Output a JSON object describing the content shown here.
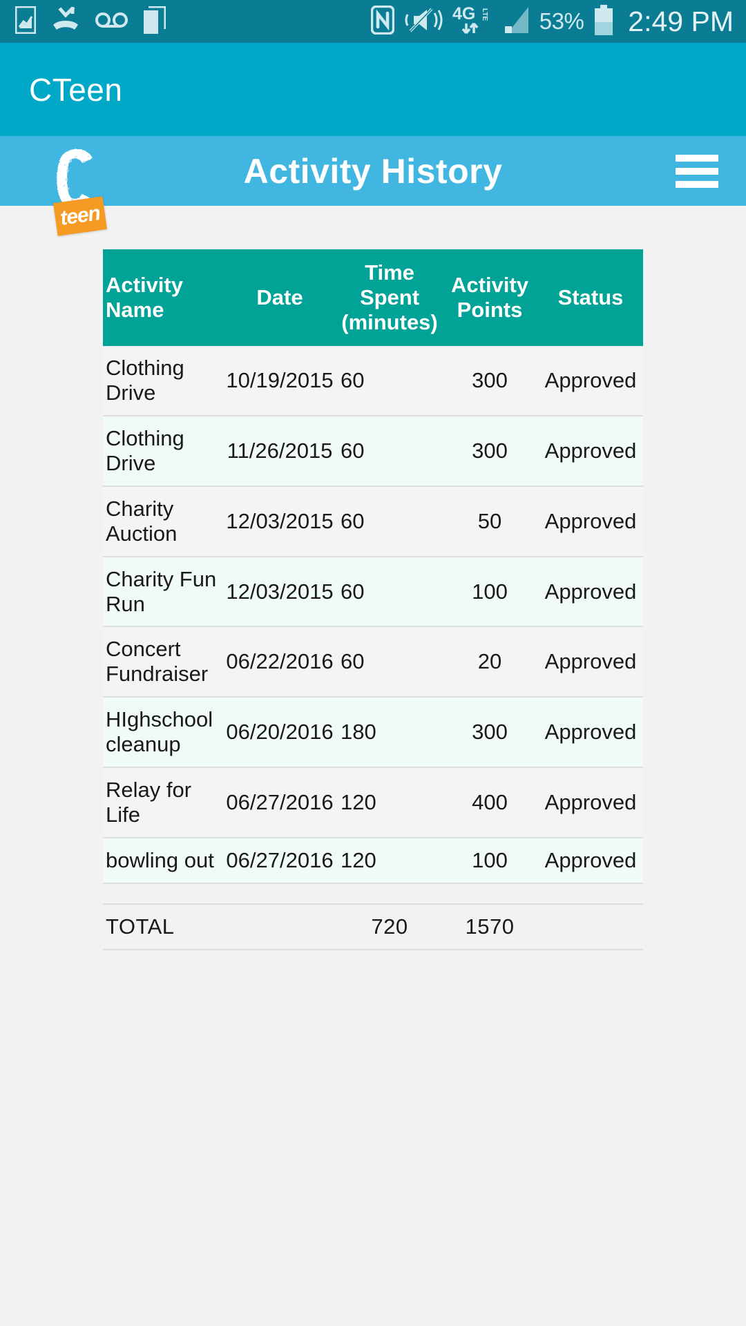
{
  "status_bar": {
    "icons_left": [
      "screenshot-captured-icon",
      "missed-call-icon",
      "voicemail-icon",
      "sim-card-icon"
    ],
    "icons_right": [
      "nfc-icon",
      "vibrate-mute-icon",
      "4g-lte-icon",
      "signal-bars-icon"
    ],
    "network_label": "4G",
    "network_sub": "LTE",
    "battery_percent": "53%",
    "time": "2:49 PM"
  },
  "app_bar": {
    "title": "CTeen"
  },
  "page_header": {
    "title": "Activity History",
    "logo_letter": "C",
    "logo_tag": "teen",
    "menu_icon": "hamburger-menu-icon"
  },
  "table": {
    "headers": {
      "name": "Activity Name",
      "date": "Date",
      "time": "Time Spent (minutes)",
      "points": "Activity Points",
      "status": "Status"
    },
    "rows": [
      {
        "name": "Clothing Drive",
        "date": "10/19/2015",
        "time": "60",
        "points": "300",
        "status": "Approved"
      },
      {
        "name": "Clothing Drive",
        "date": "11/26/2015",
        "time": "60",
        "points": "300",
        "status": "Approved"
      },
      {
        "name": "Charity Auction",
        "date": "12/03/2015",
        "time": "60",
        "points": "50",
        "status": "Approved"
      },
      {
        "name": "Charity Fun Run",
        "date": "12/03/2015",
        "time": "60",
        "points": "100",
        "status": "Approved"
      },
      {
        "name": "Concert Fundraiser",
        "date": "06/22/2016",
        "time": "60",
        "points": "20",
        "status": "Approved"
      },
      {
        "name": "HIghschool cleanup",
        "date": "06/20/2016",
        "time": "180",
        "points": "300",
        "status": "Approved"
      },
      {
        "name": "Relay for Life",
        "date": "06/27/2016",
        "time": "120",
        "points": "400",
        "status": "Approved"
      },
      {
        "name": "bowling out",
        "date": "06/27/2016",
        "time": "120",
        "points": "100",
        "status": "Approved"
      }
    ],
    "total": {
      "label": "TOTAL",
      "date": "",
      "time": "720",
      "points": "1570",
      "status": ""
    }
  },
  "colors": {
    "status_bar": "#0a7d94",
    "app_bar": "#00a8c8",
    "page_header": "#41b6e0",
    "table_header": "#00a396",
    "row_odd": "#f4f4f4",
    "row_even": "#f0faf7",
    "accent_orange": "#f59a23",
    "page_background": "#f2f2f2"
  }
}
